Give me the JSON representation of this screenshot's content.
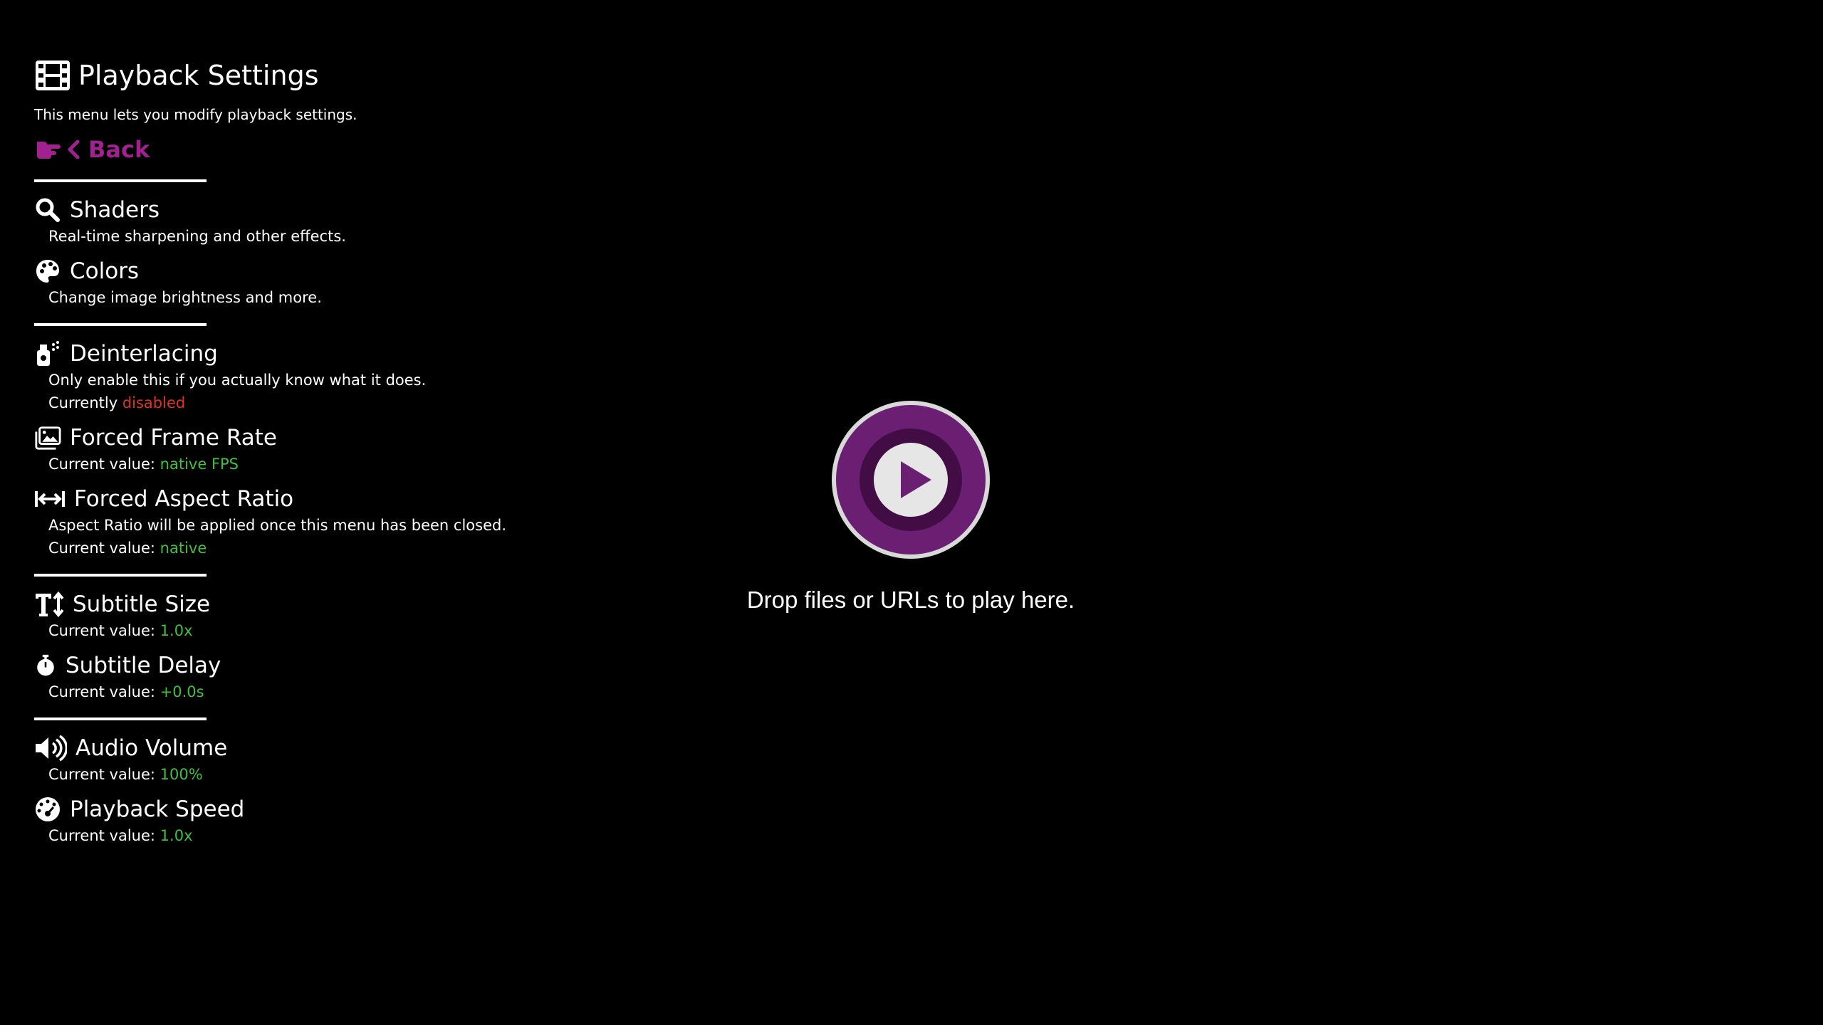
{
  "menu": {
    "title": "Playback Settings",
    "description": "This menu lets you modify playback settings.",
    "back_label": "Back",
    "items": [
      {
        "icon": "magnifier-icon",
        "label": "Shaders",
        "lines": [
          {
            "text": "Real-time sharpening and other effects."
          }
        ]
      },
      {
        "icon": "palette-icon",
        "label": "Colors",
        "lines": [
          {
            "text": "Change image brightness and more."
          }
        ]
      },
      {
        "icon": "spray-bottle-icon",
        "label": "Deinterlacing",
        "lines": [
          {
            "text": "Only enable this if you actually know what it does."
          },
          {
            "prefix": "Currently ",
            "value": "disabled",
            "value_color": "red"
          }
        ]
      },
      {
        "icon": "images-icon",
        "label": "Forced Frame Rate",
        "lines": [
          {
            "prefix": "Current value: ",
            "value": "native FPS",
            "value_color": "green"
          }
        ]
      },
      {
        "icon": "arrows-horizontal-icon",
        "label": "Forced Aspect Ratio",
        "lines": [
          {
            "text": "Aspect Ratio will be applied once this menu has been closed."
          },
          {
            "prefix": "Current value: ",
            "value": "native",
            "value_color": "green"
          }
        ]
      },
      {
        "icon": "text-height-icon",
        "label": "Subtitle Size",
        "lines": [
          {
            "prefix": "Current value: ",
            "value": "1.0x",
            "value_color": "green"
          }
        ]
      },
      {
        "icon": "stopwatch-icon",
        "label": "Subtitle Delay",
        "lines": [
          {
            "prefix": "Current value: ",
            "value": "+0.0s",
            "value_color": "green"
          }
        ]
      },
      {
        "icon": "volume-icon",
        "label": "Audio Volume",
        "lines": [
          {
            "prefix": "Current value: ",
            "value": "100%",
            "value_color": "green"
          }
        ]
      },
      {
        "icon": "speedometer-icon",
        "label": "Playback Speed",
        "lines": [
          {
            "prefix": "Current value: ",
            "value": "1.0x",
            "value_color": "green"
          }
        ]
      }
    ]
  },
  "center": {
    "logo_icon": "play-logo-icon",
    "drop_text": "Drop files or URLs to play here."
  },
  "colors": {
    "accent": "#a0218f",
    "value_green": "#3ec13e",
    "value_red": "#e03222",
    "logo_outer": "#7b2a84",
    "logo_inner": "#4a0d4d"
  }
}
